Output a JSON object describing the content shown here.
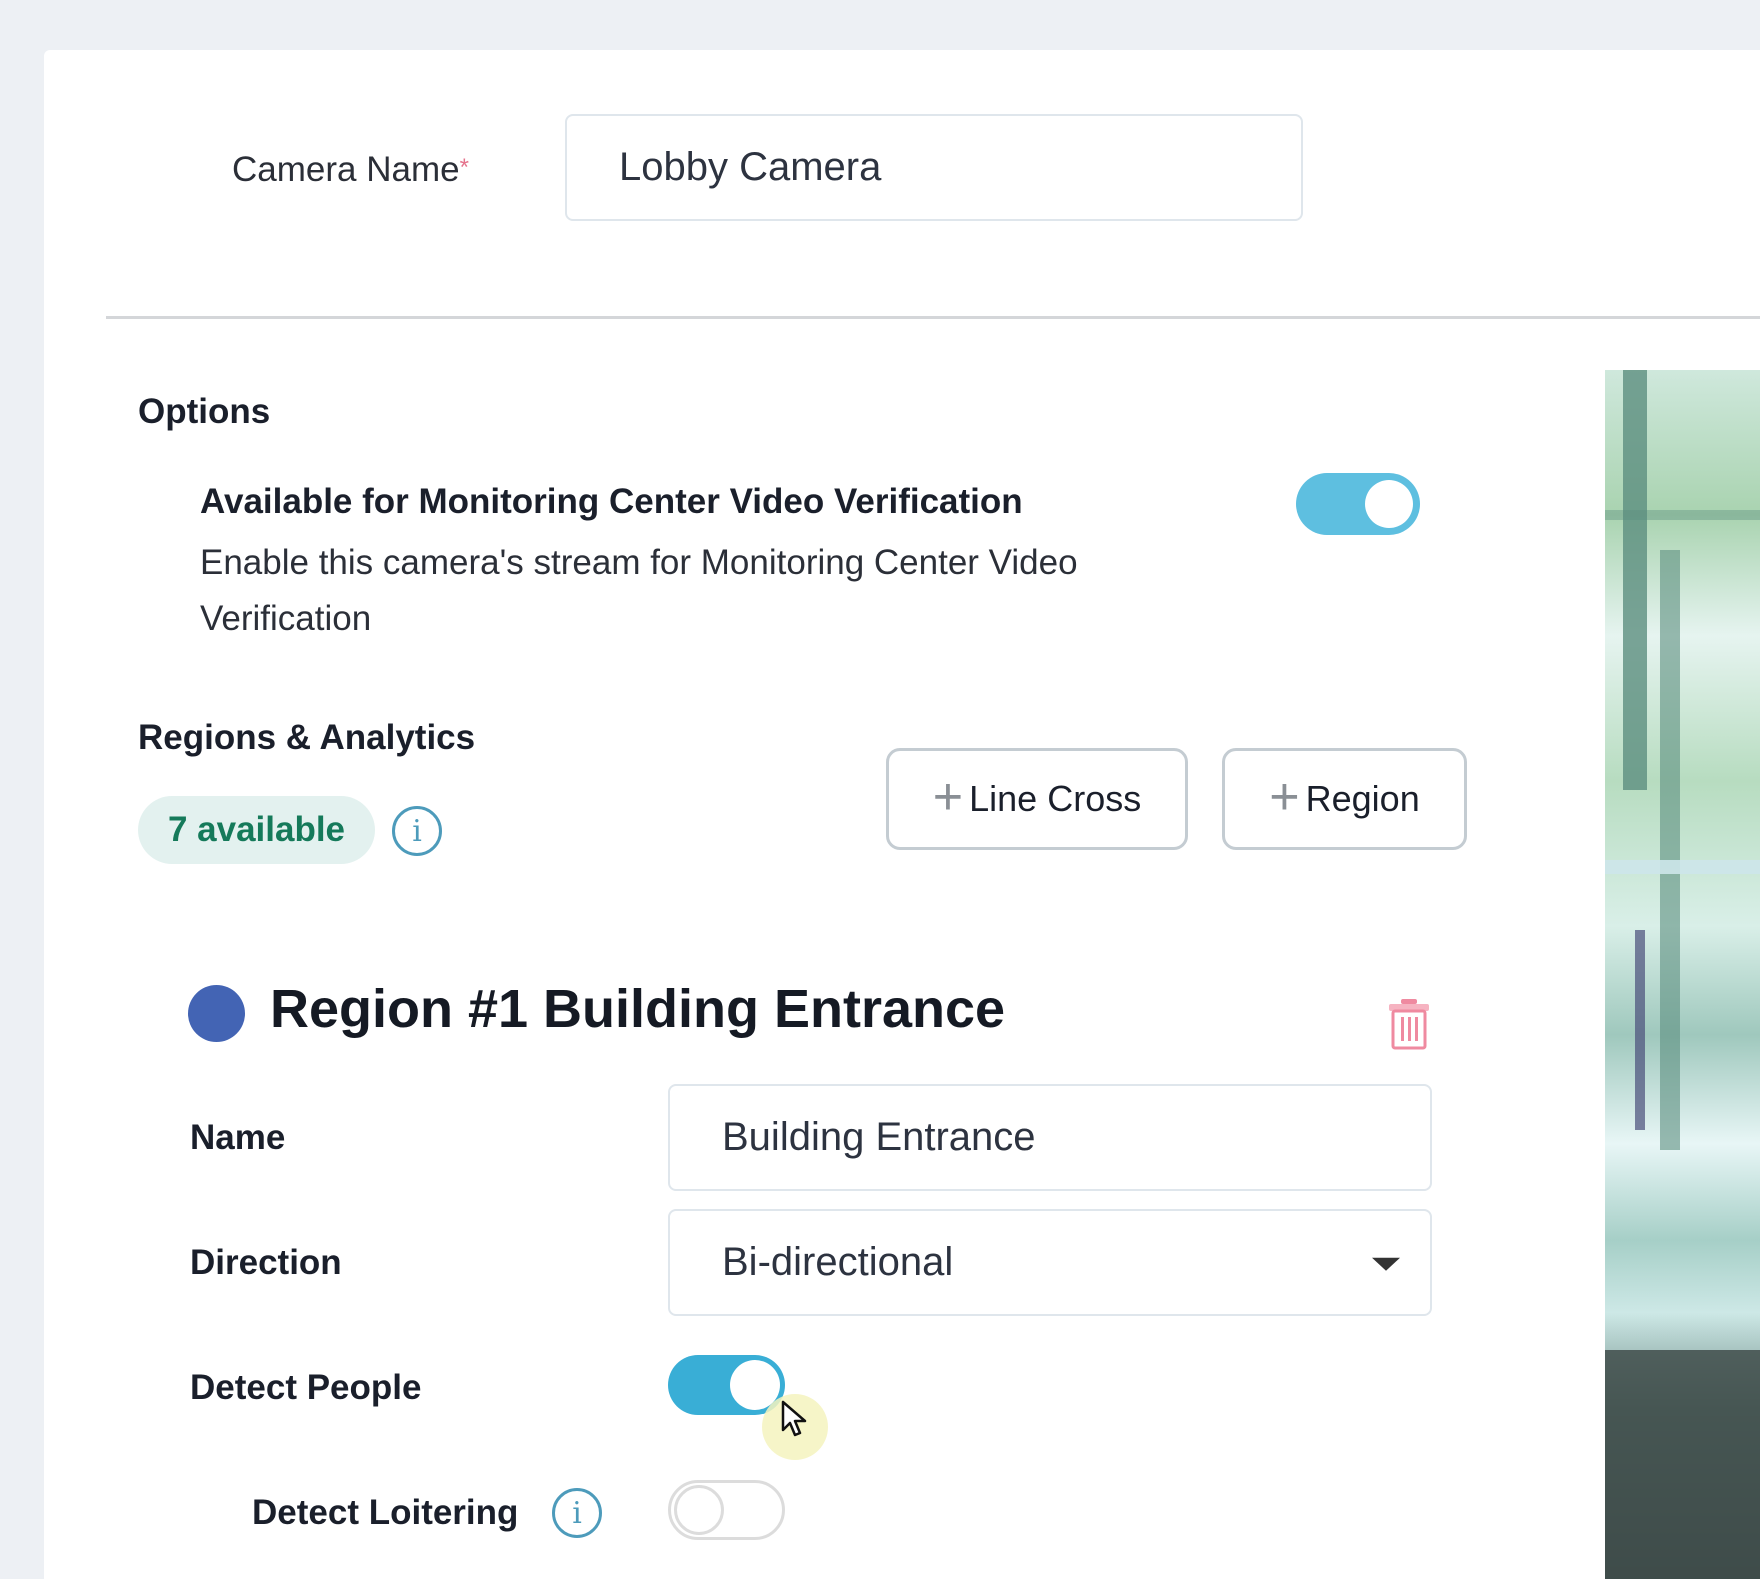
{
  "form": {
    "camera_name_label": "Camera Name",
    "camera_name_required_mark": "*",
    "camera_name_value": "Lobby Camera"
  },
  "options": {
    "heading": "Options",
    "monitoring": {
      "title": "Available for Monitoring Center Video Verification",
      "description": "Enable this camera's stream for Monitoring Center Video Verification",
      "enabled": true
    }
  },
  "regions": {
    "heading": "Regions & Analytics",
    "available_badge": "7 available",
    "info_icon": "info-icon",
    "buttons": {
      "line_cross": "Line Cross",
      "region": "Region",
      "plus_glyph": "+"
    },
    "region_1": {
      "title": "Region #1 Building Entrance",
      "color": "#4364b4",
      "delete_icon": "trash-icon",
      "name_label": "Name",
      "name_value": "Building Entrance",
      "direction_label": "Direction",
      "direction_value": "Bi-directional",
      "detect_people_label": "Detect People",
      "detect_people_enabled": true,
      "detect_loitering_label": "Detect Loitering",
      "detect_loitering_enabled": false
    }
  },
  "icons": {
    "info_glyph": "i"
  },
  "colors": {
    "toggle_on": "#39aed6",
    "badge_text": "#157a5a",
    "badge_bg": "#e3f1ef",
    "delete": "#ef8aa0",
    "required": "#e5748d"
  }
}
